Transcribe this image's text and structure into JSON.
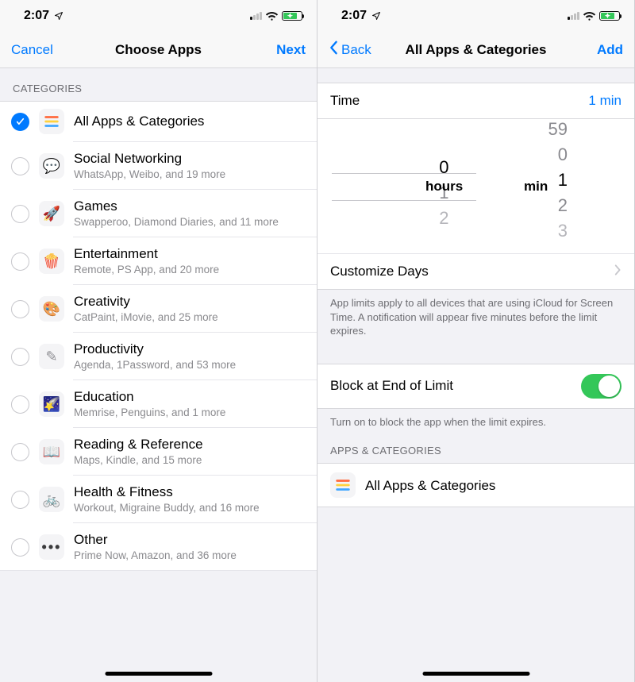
{
  "status": {
    "time": "2:07"
  },
  "left": {
    "nav": {
      "left": "Cancel",
      "title": "Choose Apps",
      "right": "Next"
    },
    "section_header": "CATEGORIES",
    "rows": [
      {
        "title": "All Apps & Categories",
        "sub": "",
        "checked": true,
        "icon": "stack"
      },
      {
        "title": "Social Networking",
        "sub": "WhatsApp, Weibo, and 19 more",
        "checked": false,
        "icon": "chat"
      },
      {
        "title": "Games",
        "sub": "Swapperoo, Diamond Diaries, and 11 more",
        "checked": false,
        "icon": "rocket"
      },
      {
        "title": "Entertainment",
        "sub": "Remote, PS App, and 20 more",
        "checked": false,
        "icon": "popcorn"
      },
      {
        "title": "Creativity",
        "sub": "CatPaint, iMovie, and 25 more",
        "checked": false,
        "icon": "paint"
      },
      {
        "title": "Productivity",
        "sub": "Agenda, 1Password, and 53 more",
        "checked": false,
        "icon": "pen"
      },
      {
        "title": "Education",
        "sub": "Memrise, Penguins, and 1 more",
        "checked": false,
        "icon": "shooting"
      },
      {
        "title": "Reading & Reference",
        "sub": "Maps, Kindle, and 15 more",
        "checked": false,
        "icon": "book"
      },
      {
        "title": "Health & Fitness",
        "sub": "Workout, Migraine Buddy, and 16 more",
        "checked": false,
        "icon": "bike"
      },
      {
        "title": "Other",
        "sub": "Prime Now, Amazon, and 36 more",
        "checked": false,
        "icon": "dots"
      }
    ]
  },
  "right": {
    "nav": {
      "back": "Back",
      "title": "All Apps & Categories",
      "right": "Add"
    },
    "time_row": {
      "label": "Time",
      "value": "1 min"
    },
    "picker": {
      "hours_sel": "0",
      "hours_unit": "hours",
      "mins_sel": "1",
      "mins_unit": "min"
    },
    "customize": "Customize Days",
    "footer1": "App limits apply to all devices that are using iCloud for Screen Time. A notification will appear five minutes before the limit expires.",
    "block": {
      "label": "Block at End of Limit",
      "on": true
    },
    "footer2": "Turn on to block the app when the limit expires.",
    "apps_header": "APPS & CATEGORIES",
    "apps_row": {
      "title": "All Apps & Categories"
    }
  }
}
